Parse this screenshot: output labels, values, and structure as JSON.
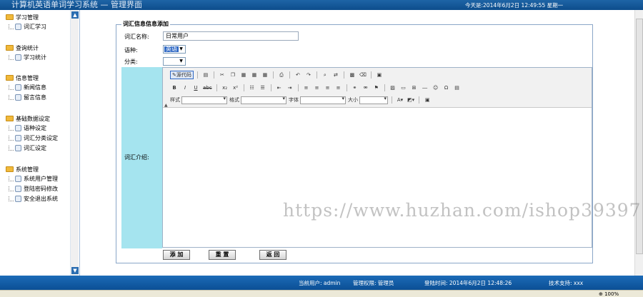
{
  "header": {
    "title": "计算机英语单词学习系统 — 管理界面",
    "date": "今天是:2014年6月2日  12:49:55  星期一"
  },
  "sidebar": {
    "groups": [
      {
        "title": "学习管理",
        "items": [
          "词汇学习"
        ]
      },
      {
        "title": "查询统计",
        "items": [
          "学习统计"
        ]
      },
      {
        "title": "信息管理",
        "items": [
          "新闻信息",
          "留言信息"
        ]
      },
      {
        "title": "基础数据设定",
        "items": [
          "语种设定",
          "词汇分类设定",
          "词汇设定"
        ]
      },
      {
        "title": "系统管理",
        "items": [
          "系统用户管理",
          "登陆密码修改",
          "安全退出系统"
        ]
      }
    ]
  },
  "form": {
    "legend": "词汇信息信息添加",
    "name_label": "词汇名称:",
    "name_value": "日常用户",
    "lang_label": "语种:",
    "lang_value": "英语",
    "category_label": "分类:",
    "category_value": "",
    "intro_label": "词汇介绍:"
  },
  "editor": {
    "source_label": "源代码",
    "style_label": "样式",
    "format_label": "格式",
    "font_label": "字体",
    "size_label": "大小"
  },
  "buttons": {
    "add": "添 加",
    "reset": "重 置",
    "back": "返 回"
  },
  "watermark": "https://www.huzhan.com/ishop39397",
  "status": {
    "user": "当前用户: admin",
    "role": "管理权限: 管理员",
    "login_time": "登陆时间: 2014年6月2日  12:48:26",
    "support": "技术支持: xxx"
  },
  "browser": {
    "zoom": "100%"
  }
}
